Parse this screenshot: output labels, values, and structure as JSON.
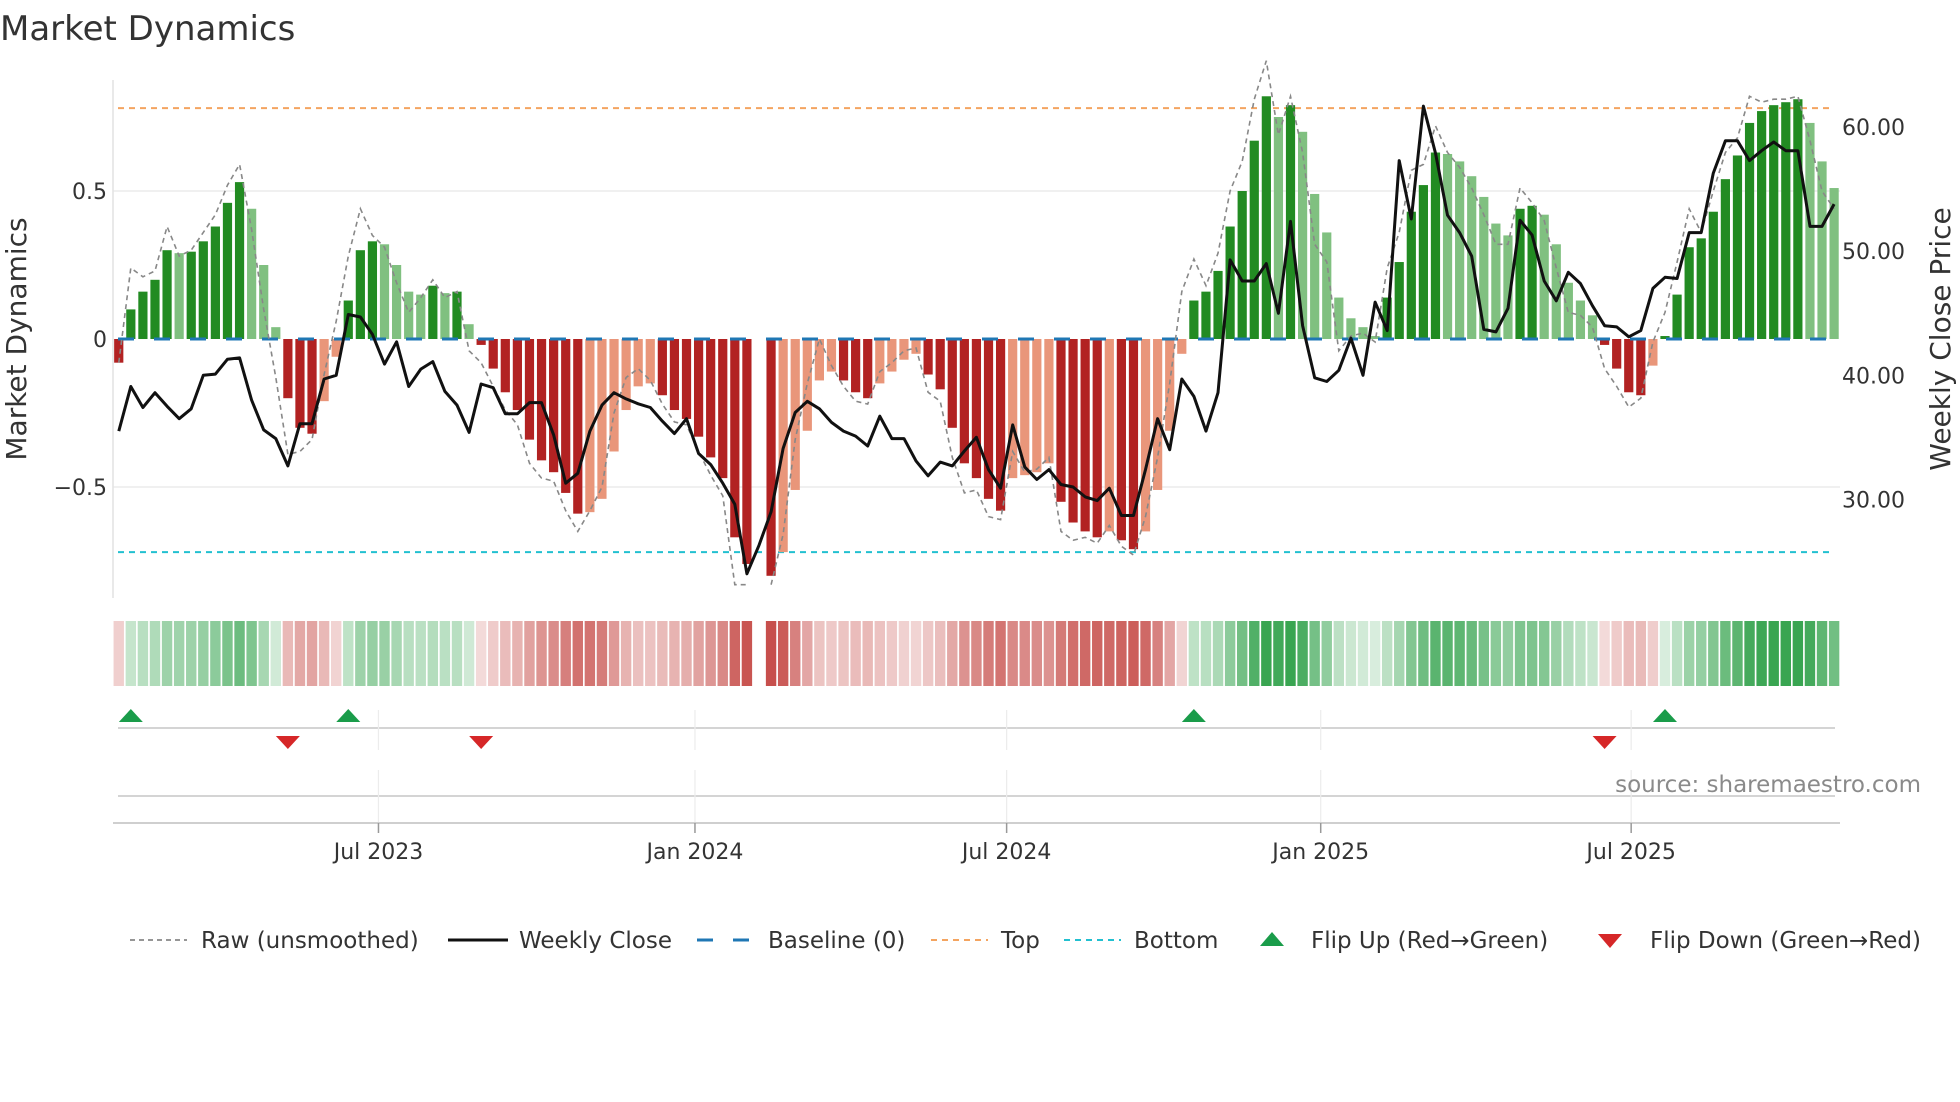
{
  "title": "Market Dynamics",
  "source": "source: sharemaestro.com",
  "colors": {
    "green_dark": "#228b22",
    "green_light": "#80c080",
    "red_dark": "#b22222",
    "red_light": "#e9967a",
    "baseline": "#1f77b4",
    "top": "#f4a460",
    "bottom": "#22c0d0",
    "raw": "#888888",
    "close": "#111111",
    "flip_up": "#1a9c4a",
    "flip_down": "#d62728"
  },
  "chart_data": {
    "type": "bar",
    "title": "Market Dynamics",
    "xlabel": "",
    "ylabel": "Market Dynamics",
    "ylabel_right": "Weekly Close Price",
    "ylim": [
      -0.875,
      0.875
    ],
    "ylim_right": [
      22.05,
      63.8
    ],
    "grid": true,
    "legend_position": "bottom",
    "top": 0.78,
    "bottom": -0.72,
    "baseline": 0,
    "yticks": [
      {
        "v": 0.5,
        "label": "0.5"
      },
      {
        "v": 0,
        "label": "0"
      },
      {
        "v": -0.5,
        "label": "−0.5"
      }
    ],
    "yticks_right": [
      {
        "v": 60,
        "label": "60.00"
      },
      {
        "v": 50,
        "label": "50.00"
      },
      {
        "v": 40,
        "label": "40.00"
      },
      {
        "v": 30,
        "label": "30.00"
      }
    ],
    "xticks": [
      {
        "week": 21.5,
        "label": "Jul 2023"
      },
      {
        "week": 47.7,
        "label": "Jan 2024"
      },
      {
        "week": 73.5,
        "label": "Jul 2024"
      },
      {
        "week": 99.5,
        "label": "Jan 2025"
      },
      {
        "week": 125.2,
        "label": "Jul 2025"
      }
    ],
    "dynamics": [
      -0.08,
      0.1,
      0.16,
      0.2,
      0.3,
      0.29,
      0.295,
      0.33,
      0.38,
      0.46,
      0.53,
      0.44,
      0.25,
      0.04,
      -0.2,
      -0.3,
      -0.32,
      -0.21,
      -0.06,
      0.13,
      0.3,
      0.33,
      0.32,
      0.25,
      0.16,
      0.15,
      0.18,
      0.155,
      0.16,
      0.05,
      -0.02,
      -0.1,
      -0.18,
      -0.24,
      -0.34,
      -0.41,
      -0.45,
      -0.52,
      -0.59,
      -0.585,
      -0.54,
      -0.38,
      -0.24,
      -0.16,
      -0.15,
      -0.19,
      -0.24,
      -0.27,
      -0.33,
      -0.4,
      -0.47,
      -0.67,
      -0.76,
      null,
      -0.8,
      -0.72,
      -0.51,
      -0.31,
      -0.14,
      -0.11,
      -0.14,
      -0.18,
      -0.2,
      -0.15,
      -0.11,
      -0.07,
      -0.05,
      -0.12,
      -0.17,
      -0.3,
      -0.42,
      -0.47,
      -0.54,
      -0.58,
      -0.47,
      -0.46,
      -0.45,
      -0.42,
      -0.55,
      -0.62,
      -0.65,
      -0.67,
      -0.65,
      -0.68,
      -0.71,
      -0.65,
      -0.51,
      -0.31,
      -0.05,
      0.13,
      0.16,
      0.23,
      0.38,
      0.5,
      0.67,
      0.82,
      0.75,
      0.79,
      0.7,
      0.49,
      0.36,
      0.14,
      0.07,
      0.04,
      0.01,
      0.14,
      0.26,
      0.43,
      0.52,
      0.63,
      0.625,
      0.6,
      0.55,
      0.48,
      0.39,
      0.35,
      0.44,
      0.45,
      0.42,
      0.32,
      0.19,
      0.13,
      0.08,
      -0.02,
      -0.1,
      -0.18,
      -0.19,
      -0.09,
      0.01,
      0.15,
      0.31,
      0.34,
      0.43,
      0.54,
      0.62,
      0.73,
      0.77,
      0.79,
      0.8,
      0.81,
      0.73,
      0.6,
      0.51
    ],
    "raw": [
      -0.08,
      0.24,
      0.21,
      0.23,
      0.38,
      0.28,
      0.3,
      0.36,
      0.42,
      0.52,
      0.59,
      0.37,
      0.1,
      -0.13,
      -0.39,
      -0.38,
      -0.34,
      -0.12,
      0.06,
      0.28,
      0.44,
      0.35,
      0.31,
      0.19,
      0.09,
      0.14,
      0.2,
      0.14,
      0.16,
      -0.04,
      -0.08,
      -0.16,
      -0.24,
      -0.29,
      -0.42,
      -0.47,
      -0.48,
      -0.58,
      -0.65,
      -0.58,
      -0.5,
      -0.25,
      -0.13,
      -0.1,
      -0.14,
      -0.22,
      -0.28,
      -0.29,
      -0.38,
      -0.46,
      -0.53,
      -0.83,
      -0.83,
      null,
      -0.83,
      -0.66,
      -0.34,
      -0.15,
      0.0,
      -0.09,
      -0.16,
      -0.21,
      -0.22,
      -0.11,
      -0.08,
      -0.04,
      -0.03,
      -0.18,
      -0.21,
      -0.4,
      -0.52,
      -0.51,
      -0.6,
      -0.61,
      -0.38,
      -0.45,
      -0.44,
      -0.4,
      -0.65,
      -0.68,
      -0.67,
      -0.69,
      -0.63,
      -0.7,
      -0.73,
      -0.6,
      -0.4,
      -0.15,
      0.16,
      0.27,
      0.18,
      0.29,
      0.5,
      0.6,
      0.81,
      0.94,
      0.69,
      0.82,
      0.63,
      0.32,
      0.26,
      -0.04,
      0.01,
      0.02,
      -0.01,
      0.24,
      0.36,
      0.57,
      0.59,
      0.72,
      0.63,
      0.58,
      0.51,
      0.42,
      0.32,
      0.32,
      0.51,
      0.46,
      0.4,
      0.24,
      0.09,
      0.08,
      0.04,
      -0.1,
      -0.16,
      -0.23,
      -0.2,
      -0.01,
      0.09,
      0.26,
      0.44,
      0.36,
      0.5,
      0.63,
      0.68,
      0.82,
      0.8,
      0.81,
      0.81,
      0.82,
      0.67,
      0.5,
      0.44
    ],
    "close": [
      35.5,
      39.1,
      37.4,
      38.6,
      37.5,
      36.5,
      37.3,
      40.0,
      40.1,
      41.3,
      41.4,
      38.0,
      35.6,
      34.9,
      32.7,
      36.1,
      36.1,
      39.7,
      40.0,
      44.9,
      44.7,
      43.3,
      40.9,
      42.7,
      39.1,
      40.5,
      41.1,
      38.7,
      37.6,
      35.4,
      39.3,
      39.0,
      36.9,
      36.9,
      37.8,
      37.8,
      35.2,
      31.3,
      32.1,
      35.5,
      37.6,
      38.6,
      38.1,
      37.7,
      37.4,
      36.3,
      35.3,
      36.5,
      33.7,
      32.8,
      31.3,
      29.6,
      24.0,
      26.3,
      29.0,
      34.1,
      37.0,
      37.9,
      37.3,
      36.2,
      35.5,
      35.1,
      34.3,
      36.7,
      34.9,
      34.9,
      33.1,
      31.9,
      33.0,
      32.7,
      33.9,
      35.0,
      32.4,
      30.9,
      36.0,
      32.6,
      31.6,
      32.4,
      31.2,
      31.0,
      30.2,
      29.9,
      30.9,
      28.7,
      28.7,
      32.4,
      36.5,
      34.0,
      39.7,
      38.3,
      35.5,
      38.6,
      49.3,
      47.6,
      47.6,
      49.0,
      45.0,
      52.4,
      44.0,
      39.8,
      39.5,
      40.4,
      43.0,
      40.0,
      45.9,
      43.6,
      57.3,
      52.6,
      61.7,
      57.9,
      52.9,
      51.5,
      49.6,
      43.7,
      43.5,
      45.4,
      52.5,
      51.3,
      47.6,
      46.0,
      48.3,
      47.4,
      45.6,
      44.0,
      43.9,
      43.1,
      43.6,
      47.0,
      47.9,
      47.8,
      51.5,
      51.5,
      56.3,
      58.9,
      58.9,
      57.3,
      58.1,
      58.8,
      58.1,
      58.1,
      52.0,
      52.0,
      53.8
    ],
    "flip_up": [
      1,
      19,
      89,
      128
    ],
    "flip_down": [
      14,
      30,
      123
    ],
    "legend": [
      {
        "key": "raw",
        "label": "Raw (unsmoothed)"
      },
      {
        "key": "close",
        "label": "Weekly Close"
      },
      {
        "key": "baseline",
        "label": "Baseline (0)"
      },
      {
        "key": "top",
        "label": "Top"
      },
      {
        "key": "bottom",
        "label": "Bottom"
      },
      {
        "key": "flip_up",
        "label": "Flip Up (Red→Green)"
      },
      {
        "key": "flip_down",
        "label": "Flip Down (Green→Red)"
      }
    ]
  }
}
